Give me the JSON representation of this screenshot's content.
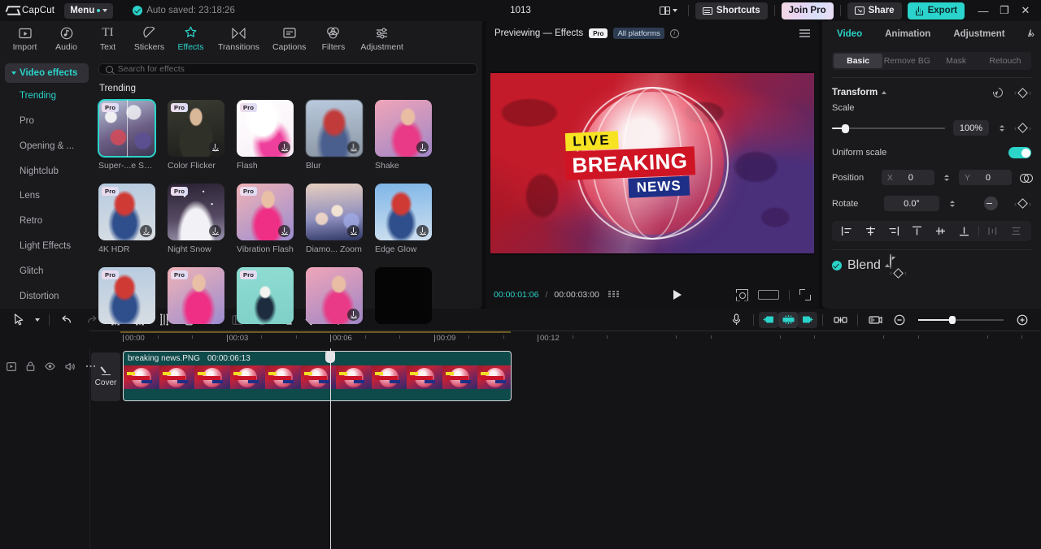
{
  "titlebar": {
    "brand": "CapCut",
    "menu_label": "Menu",
    "autosave": "Auto saved: 23:18:26",
    "doc_title": "1013",
    "shortcuts_label": "Shortcuts",
    "join_pro_label": "Join Pro",
    "share_label": "Share",
    "export_label": "Export",
    "minimize": "—",
    "maximize": "❐",
    "close": "✕"
  },
  "module_tabs": [
    {
      "label": "Import",
      "icon": "import-icon",
      "active": false
    },
    {
      "label": "Audio",
      "icon": "audio-icon",
      "active": false
    },
    {
      "label": "Text",
      "icon": "text-icon",
      "active": false
    },
    {
      "label": "Stickers",
      "icon": "stickers-icon",
      "active": false
    },
    {
      "label": "Effects",
      "icon": "effects-icon",
      "active": true
    },
    {
      "label": "Transitions",
      "icon": "transitions-icon",
      "active": false
    },
    {
      "label": "Captions",
      "icon": "captions-icon",
      "active": false
    },
    {
      "label": "Filters",
      "icon": "filters-icon",
      "active": false
    },
    {
      "label": "Adjustment",
      "icon": "adjustment-icon",
      "active": false
    }
  ],
  "effects_panel": {
    "category_header": "Video effects",
    "categories": [
      {
        "label": "Trending",
        "active": true
      },
      {
        "label": "Pro",
        "active": false
      },
      {
        "label": "Opening & ...",
        "active": false
      },
      {
        "label": "Nightclub",
        "active": false
      },
      {
        "label": "Lens",
        "active": false
      },
      {
        "label": "Retro",
        "active": false
      },
      {
        "label": "Light Effects",
        "active": false
      },
      {
        "label": "Glitch",
        "active": false
      },
      {
        "label": "Distortion",
        "active": false
      }
    ],
    "search_placeholder": "Search for effects",
    "search_value": "",
    "section_title": "Trending",
    "pro_badge": "Pro",
    "items": [
      {
        "name": "Super-...e Spot",
        "pro": true,
        "download": false,
        "selected": true,
        "fill": "f-bokeh",
        "split": true
      },
      {
        "name": "Color Flicker",
        "pro": true,
        "download": true,
        "selected": false,
        "fill": "f-girl-dark",
        "split": false
      },
      {
        "name": "Flash",
        "pro": true,
        "download": true,
        "selected": false,
        "fill": "f-flashwhite",
        "split": false
      },
      {
        "name": "Blur",
        "pro": false,
        "download": true,
        "selected": false,
        "fill": "f-blurboy",
        "split": false
      },
      {
        "name": "Shake",
        "pro": false,
        "download": true,
        "selected": false,
        "fill": "f-pinkgirl",
        "split": false
      },
      {
        "name": "4K HDR",
        "pro": true,
        "download": true,
        "selected": false,
        "fill": "f-boy4k",
        "split": false
      },
      {
        "name": "Night Snow",
        "pro": true,
        "download": true,
        "selected": false,
        "fill": "f-snow",
        "split": false
      },
      {
        "name": "Vibration Flash",
        "pro": true,
        "download": true,
        "selected": false,
        "fill": "f-vibr",
        "split": false
      },
      {
        "name": "Diamo... Zoom",
        "pro": false,
        "download": true,
        "selected": false,
        "fill": "f-diam",
        "split": false
      },
      {
        "name": "Edge Glow",
        "pro": false,
        "download": true,
        "selected": false,
        "fill": "f-edge",
        "split": false
      },
      {
        "name": "",
        "pro": true,
        "download": false,
        "selected": false,
        "fill": "f-boy4k",
        "split": false
      },
      {
        "name": "",
        "pro": true,
        "download": false,
        "selected": false,
        "fill": "f-vibr",
        "split": false
      },
      {
        "name": "",
        "pro": true,
        "download": false,
        "selected": false,
        "fill": "f-teal",
        "split": false
      },
      {
        "name": "",
        "pro": false,
        "download": true,
        "selected": false,
        "fill": "f-pinkgirl",
        "split": false
      },
      {
        "name": "",
        "pro": false,
        "download": false,
        "selected": false,
        "fill": "f-black",
        "split": false
      }
    ]
  },
  "preview": {
    "title": "Previewing — Effects",
    "pro_chip": "Pro",
    "platform_chip": "All platforms",
    "current_time": "00:00:01:06",
    "time_separator": "/",
    "total_time": "00:00:03:00",
    "video": {
      "live_text": "LIVE",
      "breaking_text": "BREAKING",
      "news_text": "NEWS"
    }
  },
  "properties": {
    "tabs": [
      {
        "label": "Video",
        "active": true
      },
      {
        "label": "Animation",
        "active": false
      },
      {
        "label": "Adjustment",
        "active": false
      },
      {
        "label": "AI stylize",
        "active": false
      }
    ],
    "more": "»",
    "segments": [
      {
        "label": "Basic",
        "active": true
      },
      {
        "label": "Remove BG",
        "active": false
      },
      {
        "label": "Mask",
        "active": false
      },
      {
        "label": "Retouch",
        "active": false
      }
    ],
    "transform_title": "Transform",
    "scale_label": "Scale",
    "scale_value": "100%",
    "uniform_scale_label": "Uniform scale",
    "uniform_scale_on": true,
    "position_label": "Position",
    "position_x_axis": "X",
    "position_x_value": "0",
    "position_y_axis": "Y",
    "position_y_value": "0",
    "rotate_label": "Rotate",
    "rotate_value": "0.0°",
    "blend_label": "Blend",
    "blend_enabled": true
  },
  "timeline": {
    "tools": [
      {
        "name": "select-tool",
        "dim": false
      },
      {
        "name": "undo-tool",
        "dim": false
      },
      {
        "name": "redo-tool",
        "dim": true
      },
      {
        "name": "split-tool",
        "dim": false
      },
      {
        "name": "trim-left-tool",
        "dim": false
      },
      {
        "name": "trim-right-tool",
        "dim": false
      },
      {
        "name": "delete-tool",
        "dim": false
      },
      {
        "name": "freeze-tool",
        "dim": true
      },
      {
        "name": "crop-frame-tool",
        "dim": true
      },
      {
        "name": "reverse-tool",
        "dim": true
      },
      {
        "name": "mirror-tool",
        "dim": false
      },
      {
        "name": "rotate-tool",
        "dim": false
      },
      {
        "name": "crop-tool",
        "dim": false
      }
    ],
    "right_tools": [
      {
        "name": "record-voiceover-icon"
      },
      {
        "name": "snap-start-icon"
      },
      {
        "name": "auto-snap-icon"
      },
      {
        "name": "snap-end-icon"
      },
      {
        "name": "link-clips-icon"
      },
      {
        "name": "preview-thumbnails-icon"
      },
      {
        "name": "zoom-out-icon"
      },
      {
        "name": "zoom-in-icon"
      }
    ],
    "ruler_labels": [
      "00:00",
      "00:03",
      "00:06",
      "00:09",
      "00:12"
    ],
    "track_controls": [
      {
        "name": "track-thumbnail-toggle"
      },
      {
        "name": "track-lock"
      },
      {
        "name": "track-visibility"
      },
      {
        "name": "track-mute"
      },
      {
        "name": "track-more"
      }
    ],
    "cover_label": "Cover",
    "clip": {
      "name": "breaking news.PNG",
      "duration": "00:00:06:13",
      "frame_live": "LIVE",
      "frame_breaking": "BREAKING",
      "frame_news": "NEWS"
    }
  },
  "colors": {
    "accent": "#2bd3c9",
    "panel_bg": "#1a1a1d",
    "app_bg": "#0d0d0f",
    "clip_bg": "#0f4a4a",
    "export_bg": "#2ad4cc"
  }
}
